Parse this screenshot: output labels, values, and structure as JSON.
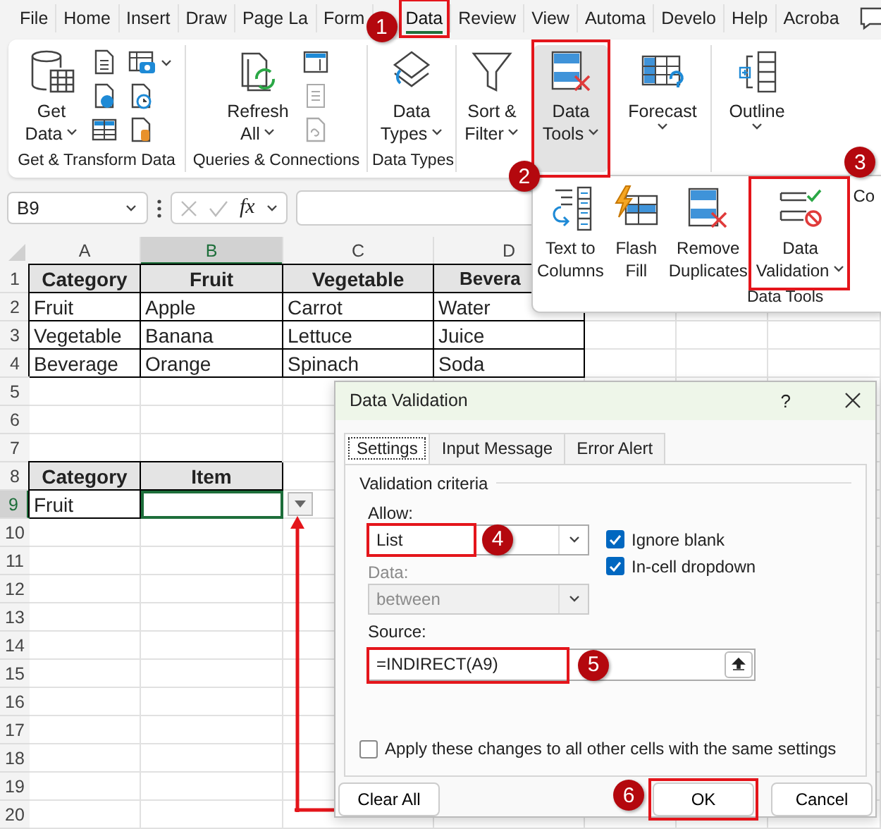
{
  "ribbon_tabs": [
    {
      "label": "File",
      "selected": false
    },
    {
      "label": "Home",
      "selected": false
    },
    {
      "label": "Insert",
      "selected": false
    },
    {
      "label": "Draw",
      "selected": false
    },
    {
      "label": "Page La",
      "selected": false
    },
    {
      "label": "Form",
      "selected": false
    },
    {
      "label": "Data",
      "selected": true
    },
    {
      "label": "Review",
      "selected": false
    },
    {
      "label": "View",
      "selected": false
    },
    {
      "label": "Automa",
      "selected": false
    },
    {
      "label": "Develo",
      "selected": false
    },
    {
      "label": "Help",
      "selected": false
    },
    {
      "label": "Acroba",
      "selected": false
    }
  ],
  "ribbon_groups": [
    {
      "label": "Get & Transform Data",
      "button": {
        "lines": [
          "Get",
          "Data"
        ],
        "pressed": false
      }
    },
    {
      "label": "Queries & Connections",
      "button": {
        "lines": [
          "Refresh",
          "All"
        ],
        "pressed": false
      }
    },
    {
      "label": "Data Types",
      "button": {
        "lines": [
          "Data",
          "Types"
        ],
        "pressed": false
      }
    },
    {
      "button": {
        "lines": [
          "Sort &",
          "Filter"
        ],
        "pressed": false
      }
    },
    {
      "button": {
        "lines": [
          "Data",
          "Tools"
        ],
        "pressed": true
      }
    },
    {
      "button": {
        "lines": [
          "Forecast"
        ],
        "pressed": false
      }
    },
    {
      "button": {
        "lines": [
          "Outline"
        ],
        "pressed": false
      }
    }
  ],
  "data_tools_menu": {
    "label": "Data Tools",
    "buttons": [
      {
        "lines": [
          "Text to",
          "Columns"
        ]
      },
      {
        "lines": [
          "Flash",
          "Fill"
        ]
      },
      {
        "lines": [
          "Remove",
          "Duplicates"
        ]
      },
      {
        "lines": [
          "Data",
          "Validation"
        ]
      },
      {
        "lines": [
          "Co"
        ]
      }
    ]
  },
  "formula_bar": {
    "name_box": "B9",
    "function_label": "fx"
  },
  "sheet": {
    "columns": [
      "A",
      "B",
      "C",
      "D"
    ],
    "rows": [
      {
        "number": "1",
        "cells": [
          {
            "text": "Category",
            "kind": "header",
            "selected": false
          },
          {
            "text": "Fruit",
            "kind": "header",
            "selected": false
          },
          {
            "text": "Vegetable",
            "kind": "header",
            "selected": false
          },
          {
            "text": "Bevera",
            "kind": "header",
            "selected": false
          }
        ]
      },
      {
        "number": "2",
        "cells": [
          {
            "text": "Fruit",
            "kind": "data",
            "selected": false
          },
          {
            "text": "Apple",
            "kind": "data",
            "selected": false
          },
          {
            "text": "Carrot",
            "kind": "data",
            "selected": false
          },
          {
            "text": "Water",
            "kind": "data",
            "selected": false
          }
        ]
      },
      {
        "number": "3",
        "cells": [
          {
            "text": "Vegetable",
            "kind": "data",
            "selected": false
          },
          {
            "text": "Banana",
            "kind": "data",
            "selected": false
          },
          {
            "text": "Lettuce",
            "kind": "data",
            "selected": false
          },
          {
            "text": "Juice",
            "kind": "data",
            "selected": false
          }
        ]
      },
      {
        "number": "4",
        "cells": [
          {
            "text": "Beverage",
            "kind": "data",
            "selected": false
          },
          {
            "text": "Orange",
            "kind": "data",
            "selected": false
          },
          {
            "text": "Spinach",
            "kind": "data",
            "selected": false
          },
          {
            "text": "Soda",
            "kind": "data",
            "selected": false
          }
        ]
      },
      {
        "number": "5"
      },
      {
        "number": "6"
      },
      {
        "number": "7"
      },
      {
        "number": "8",
        "cells": [
          {
            "text": "Category",
            "kind": "header",
            "selected": false
          },
          {
            "text": "Item",
            "kind": "header",
            "selected": false
          }
        ]
      },
      {
        "number": "9",
        "cells": [
          {
            "text": "Fruit",
            "kind": "data",
            "selected": false
          },
          {
            "text": "",
            "kind": "data",
            "selected": true
          }
        ]
      },
      {
        "number": "10"
      },
      {
        "number": "11"
      },
      {
        "number": "12"
      },
      {
        "number": "13"
      },
      {
        "number": "14"
      },
      {
        "number": "15"
      },
      {
        "number": "16"
      },
      {
        "number": "17"
      },
      {
        "number": "18"
      },
      {
        "number": "19"
      },
      {
        "number": "20"
      }
    ]
  },
  "dialog": {
    "title": "Data Validation",
    "help": "?",
    "tabs": [
      {
        "label": "Settings",
        "selected": true
      },
      {
        "label": "Input Message",
        "selected": false
      },
      {
        "label": "Error Alert",
        "selected": false
      }
    ],
    "section": "Validation criteria",
    "allow": {
      "label": "Allow:",
      "value": "List"
    },
    "data": {
      "label": "Data:",
      "value": "between",
      "disabled": true
    },
    "source": {
      "label": "Source:",
      "value": "=INDIRECT(A9)"
    },
    "options": [
      {
        "label": "Ignore blank",
        "checked": true
      },
      {
        "label": "In-cell dropdown",
        "checked": true
      }
    ],
    "apply_all": {
      "label": "Apply these changes to all other cells with the same settings",
      "checked": false
    },
    "buttons": [
      {
        "label": "Clear All"
      },
      {
        "label": "OK"
      },
      {
        "label": "Cancel"
      }
    ]
  },
  "callouts": [
    {
      "label": "1"
    },
    {
      "label": "2"
    },
    {
      "label": "3"
    },
    {
      "label": "4"
    },
    {
      "label": "5"
    },
    {
      "label": "6"
    }
  ]
}
